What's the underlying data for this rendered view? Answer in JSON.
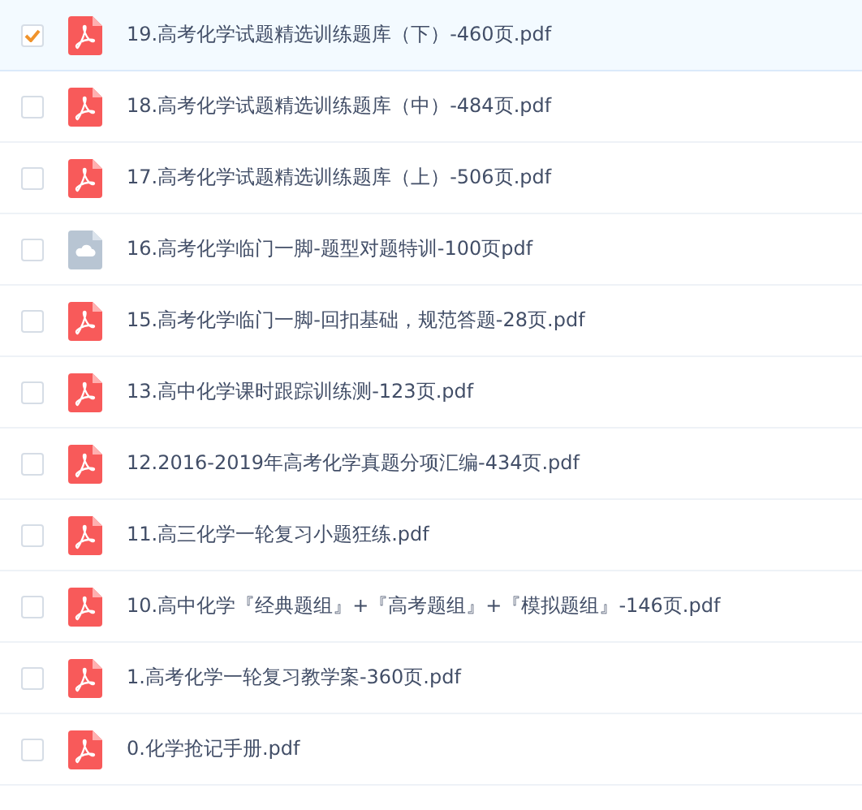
{
  "files": [
    {
      "name": "19.高考化学试题精选训练题库（下）-460页.pdf",
      "kind": "pdf",
      "selected": true
    },
    {
      "name": "18.高考化学试题精选训练题库（中）-484页.pdf",
      "kind": "pdf",
      "selected": false
    },
    {
      "name": "17.高考化学试题精选训练题库（上）-506页.pdf",
      "kind": "pdf",
      "selected": false
    },
    {
      "name": "16.高考化学临门一脚-题型对题特训-100页pdf",
      "kind": "cloud",
      "selected": false
    },
    {
      "name": "15.高考化学临门一脚-回扣基础，规范答题-28页.pdf",
      "kind": "pdf",
      "selected": false
    },
    {
      "name": "13.高中化学课时跟踪训练测-123页.pdf",
      "kind": "pdf",
      "selected": false
    },
    {
      "name": "12.2016-2019年高考化学真题分项汇编-434页.pdf",
      "kind": "pdf",
      "selected": false
    },
    {
      "name": "11.高三化学一轮复习小题狂练.pdf",
      "kind": "pdf",
      "selected": false
    },
    {
      "name": "10.高中化学『经典题组』+『高考题组』+『模拟题组』-146页.pdf",
      "kind": "pdf",
      "selected": false
    },
    {
      "name": "1.高考化学一轮复习教学案-360页.pdf",
      "kind": "pdf",
      "selected": false
    },
    {
      "name": "0.化学抢记手册.pdf",
      "kind": "pdf",
      "selected": false
    }
  ]
}
